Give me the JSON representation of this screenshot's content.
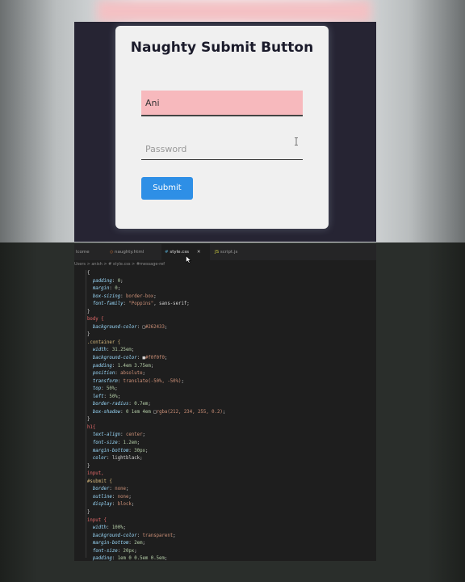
{
  "preview": {
    "title": "Naughty Submit Button",
    "username_value": "Ani",
    "password_placeholder": "Password",
    "submit_label": "Submit"
  },
  "editor": {
    "tabs": [
      {
        "label": "lcome",
        "icon": "file-icon"
      },
      {
        "label": "naughty.html",
        "icon": "html-icon"
      },
      {
        "label": "style.css",
        "icon": "css-icon"
      },
      {
        "label": "script.js",
        "icon": "js-icon"
      }
    ],
    "breadcrumb": "Users > anish > # style.css > #message-ref",
    "lines": [
      [
        [
          "{",
          "plain"
        ]
      ],
      [
        [
          "  padding",
          "prop"
        ],
        [
          ": ",
          "plain"
        ],
        [
          "0",
          "num"
        ],
        [
          ";",
          "plain"
        ]
      ],
      [
        [
          "  margin",
          "prop"
        ],
        [
          ": ",
          "plain"
        ],
        [
          "0",
          "num"
        ],
        [
          ";",
          "plain"
        ]
      ],
      [
        [
          "  box-sizing",
          "prop"
        ],
        [
          ": ",
          "plain"
        ],
        [
          "border-box",
          "val"
        ],
        [
          ";",
          "plain"
        ]
      ],
      [
        [
          "  font-family",
          "prop"
        ],
        [
          ": ",
          "plain"
        ],
        [
          "\"Poppins\"",
          "val"
        ],
        [
          ", sans-serif;",
          "plain"
        ]
      ],
      [
        [
          "}",
          "plain"
        ]
      ],
      [
        [
          "body {",
          "red"
        ]
      ],
      [
        [
          "  background-color",
          "prop"
        ],
        [
          ": ",
          "plain"
        ],
        [
          "□",
          "plain"
        ],
        [
          "#262433",
          "val"
        ],
        [
          ";",
          "plain"
        ]
      ],
      [
        [
          "}",
          "plain"
        ]
      ],
      [
        [
          ".container {",
          "sel"
        ]
      ],
      [
        [
          "  width",
          "prop"
        ],
        [
          ": ",
          "plain"
        ],
        [
          "31.25em",
          "num"
        ],
        [
          ";",
          "plain"
        ]
      ],
      [
        [
          "  background-color",
          "prop"
        ],
        [
          ": ",
          "plain"
        ],
        [
          "■",
          "plain"
        ],
        [
          "#f0f0f0",
          "val"
        ],
        [
          ";",
          "plain"
        ]
      ],
      [
        [
          "  padding",
          "prop"
        ],
        [
          ": ",
          "plain"
        ],
        [
          "1.4em 3.75em",
          "num"
        ],
        [
          ";",
          "plain"
        ]
      ],
      [
        [
          "  position",
          "prop"
        ],
        [
          ": ",
          "plain"
        ],
        [
          "absolute",
          "val"
        ],
        [
          ";",
          "plain"
        ]
      ],
      [
        [
          "  transform",
          "prop"
        ],
        [
          ": ",
          "plain"
        ],
        [
          "translate(-50%, -50%)",
          "val"
        ],
        [
          ";",
          "plain"
        ]
      ],
      [
        [
          "  top",
          "prop"
        ],
        [
          ": ",
          "plain"
        ],
        [
          "50%",
          "num"
        ],
        [
          ";",
          "plain"
        ]
      ],
      [
        [
          "  left",
          "prop"
        ],
        [
          ": ",
          "plain"
        ],
        [
          "50%",
          "num"
        ],
        [
          ";",
          "plain"
        ]
      ],
      [
        [
          "  border-radius",
          "prop"
        ],
        [
          ": ",
          "plain"
        ],
        [
          "0.7em",
          "num"
        ],
        [
          ";",
          "plain"
        ]
      ],
      [
        [
          "  box-shadow",
          "prop"
        ],
        [
          ": ",
          "plain"
        ],
        [
          "0 1em 4em ",
          "num"
        ],
        [
          "□",
          "plain"
        ],
        [
          "rgba(212, 234, 255, 0.2)",
          "val"
        ],
        [
          ";",
          "plain"
        ]
      ],
      [
        [
          "}",
          "plain"
        ]
      ],
      [
        [
          "h1{",
          "red"
        ]
      ],
      [
        [
          "  text-align",
          "prop"
        ],
        [
          ": ",
          "plain"
        ],
        [
          "center",
          "val"
        ],
        [
          ";",
          "plain"
        ]
      ],
      [
        [
          "  font-size",
          "prop"
        ],
        [
          ": ",
          "plain"
        ],
        [
          "1.2em",
          "num"
        ],
        [
          ";",
          "plain"
        ]
      ],
      [
        [
          "  margin-bottom",
          "prop"
        ],
        [
          ": ",
          "plain"
        ],
        [
          "30px",
          "num"
        ],
        [
          ";",
          "plain"
        ]
      ],
      [
        [
          "  color",
          "prop"
        ],
        [
          ": ",
          "plain"
        ],
        [
          "lightblack",
          "plain"
        ],
        [
          ";",
          "plain"
        ]
      ],
      [
        [
          "}",
          "plain"
        ]
      ],
      [
        [
          "input,",
          "red"
        ]
      ],
      [
        [
          "#submit {",
          "sel"
        ]
      ],
      [
        [
          "  border",
          "prop"
        ],
        [
          ": ",
          "plain"
        ],
        [
          "none",
          "val"
        ],
        [
          ";",
          "plain"
        ]
      ],
      [
        [
          "  outline",
          "prop"
        ],
        [
          ": ",
          "plain"
        ],
        [
          "none",
          "val"
        ],
        [
          ";",
          "plain"
        ]
      ],
      [
        [
          "  display",
          "prop"
        ],
        [
          ": ",
          "plain"
        ],
        [
          "block",
          "val"
        ],
        [
          ";",
          "plain"
        ]
      ],
      [
        [
          "}",
          "plain"
        ]
      ],
      [
        [
          "input {",
          "red"
        ]
      ],
      [
        [
          "  width",
          "prop"
        ],
        [
          ": ",
          "plain"
        ],
        [
          "100%",
          "num"
        ],
        [
          ";",
          "plain"
        ]
      ],
      [
        [
          "  background-color",
          "prop"
        ],
        [
          ": ",
          "plain"
        ],
        [
          "transparent",
          "val"
        ],
        [
          ";",
          "plain"
        ]
      ],
      [
        [
          "  margin-bottom",
          "prop"
        ],
        [
          ": ",
          "plain"
        ],
        [
          "2em",
          "num"
        ],
        [
          ";",
          "plain"
        ]
      ],
      [
        [
          "  font-size",
          "prop"
        ],
        [
          ": ",
          "plain"
        ],
        [
          "20px",
          "num"
        ],
        [
          ";",
          "plain"
        ]
      ],
      [
        [
          "  padding",
          "prop"
        ],
        [
          ": ",
          "plain"
        ],
        [
          "1em 0 0.5em 0.5em",
          "num"
        ],
        [
          ";",
          "plain"
        ]
      ]
    ]
  },
  "colors": {
    "accent": "#2e8fe6",
    "input_bg": "#f7b9bd",
    "page_bg": "#262433",
    "card_bg": "#f0f0f0"
  }
}
